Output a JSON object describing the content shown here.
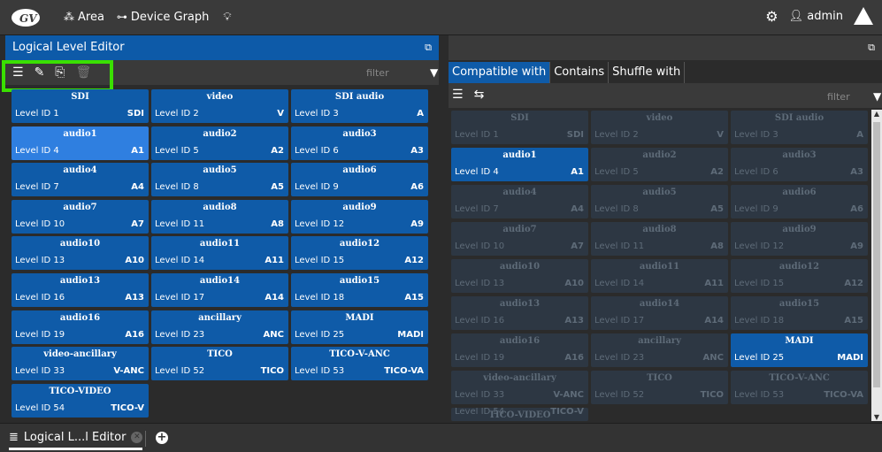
{
  "topbar": {
    "area_label": "Area",
    "device_graph_label": "Device Graph",
    "user_label": "admin"
  },
  "left_panel": {
    "title": "Logical Level Editor",
    "filter_placeholder": "filter",
    "levels": [
      {
        "name": "SDI",
        "id": "Level ID 1",
        "abbr": "SDI"
      },
      {
        "name": "video",
        "id": "Level ID 2",
        "abbr": "V"
      },
      {
        "name": "SDI audio",
        "id": "Level ID 3",
        "abbr": "A"
      },
      {
        "name": "audio1",
        "id": "Level ID 4",
        "abbr": "A1"
      },
      {
        "name": "audio2",
        "id": "Level ID 5",
        "abbr": "A2"
      },
      {
        "name": "audio3",
        "id": "Level ID 6",
        "abbr": "A3"
      },
      {
        "name": "audio4",
        "id": "Level ID 7",
        "abbr": "A4"
      },
      {
        "name": "audio5",
        "id": "Level ID 8",
        "abbr": "A5"
      },
      {
        "name": "audio6",
        "id": "Level ID 9",
        "abbr": "A6"
      },
      {
        "name": "audio7",
        "id": "Level ID 10",
        "abbr": "A7"
      },
      {
        "name": "audio8",
        "id": "Level ID 11",
        "abbr": "A8"
      },
      {
        "name": "audio9",
        "id": "Level ID 12",
        "abbr": "A9"
      },
      {
        "name": "audio10",
        "id": "Level ID 13",
        "abbr": "A10"
      },
      {
        "name": "audio11",
        "id": "Level ID 14",
        "abbr": "A11"
      },
      {
        "name": "audio12",
        "id": "Level ID 15",
        "abbr": "A12"
      },
      {
        "name": "audio13",
        "id": "Level ID 16",
        "abbr": "A13"
      },
      {
        "name": "audio14",
        "id": "Level ID 17",
        "abbr": "A14"
      },
      {
        "name": "audio15",
        "id": "Level ID 18",
        "abbr": "A15"
      },
      {
        "name": "audio16",
        "id": "Level ID 19",
        "abbr": "A16"
      },
      {
        "name": "ancillary",
        "id": "Level ID 23",
        "abbr": "ANC"
      },
      {
        "name": "MADI",
        "id": "Level ID 25",
        "abbr": "MADI"
      },
      {
        "name": "video-ancillary",
        "id": "Level ID 33",
        "abbr": "V-ANC"
      },
      {
        "name": "TICO",
        "id": "Level ID 52",
        "abbr": "TICO"
      },
      {
        "name": "TICO-V-ANC",
        "id": "Level ID 53",
        "abbr": "TICO-VA"
      },
      {
        "name": "TICO-VIDEO",
        "id": "Level ID 54",
        "abbr": "TICO-V"
      }
    ],
    "selected_index": 3
  },
  "right_panel": {
    "tabs": [
      "Compatible with",
      "Contains",
      "Shuffle with"
    ],
    "active_tab": 0,
    "filter_placeholder": "filter",
    "highlighted_indices": [
      3,
      20
    ]
  },
  "bottom_bar": {
    "tab_label": "Logical L...l Editor"
  },
  "colors": {
    "accent": "#0f5ba8",
    "selected": "#2f7fe0",
    "highlight_box": "#3ae000"
  }
}
